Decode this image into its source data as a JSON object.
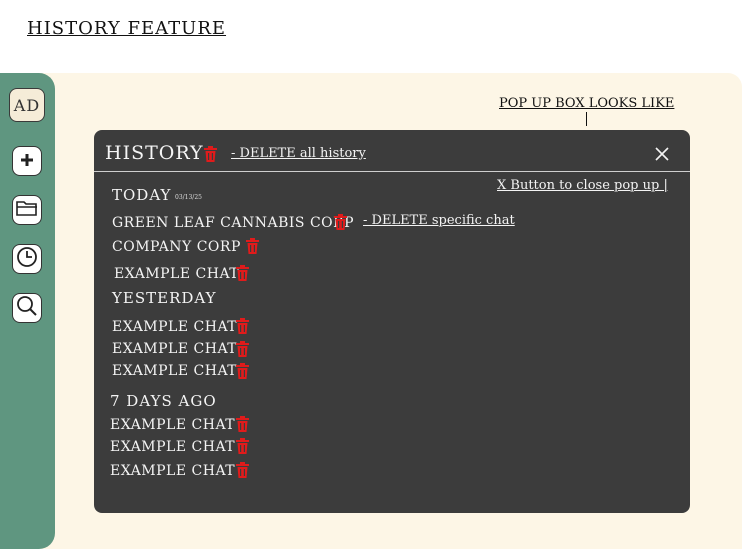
{
  "page": {
    "title": "HISTORY FEATURE"
  },
  "sidebar": {
    "avatar_label": "AD",
    "items": [
      {
        "icon": "plus-icon"
      },
      {
        "icon": "folder-icon"
      },
      {
        "icon": "clock-icon"
      },
      {
        "icon": "search-icon"
      }
    ]
  },
  "annotations": {
    "popup_note": "POP UP BOX LOOKS LIKE",
    "delete_all_note": "- DELETE all history",
    "close_note": "X Button to close pop up |",
    "delete_specific_note": "- DELETE specific chat"
  },
  "popup": {
    "title": "HISTORY",
    "sections": [
      {
        "label": "TODAY",
        "date": "03/13/25",
        "items": [
          "GREEN LEAF CANNABIS CORP",
          "COMPANY CORP",
          "EXAMPLE CHAT"
        ]
      },
      {
        "label": "YESTERDAY",
        "items": [
          "EXAMPLE CHAT",
          "EXAMPLE CHAT",
          "EXAMPLE CHAT"
        ]
      },
      {
        "label": "7 DAYS AGO",
        "items": [
          "EXAMPLE CHAT",
          "EXAMPLE CHAT",
          "EXAMPLE CHAT"
        ]
      }
    ]
  },
  "colors": {
    "sidebar": "#5f9680",
    "canvas": "#fdf6e6",
    "popup": "#3c3c3c",
    "trash": "#e01b1b"
  }
}
